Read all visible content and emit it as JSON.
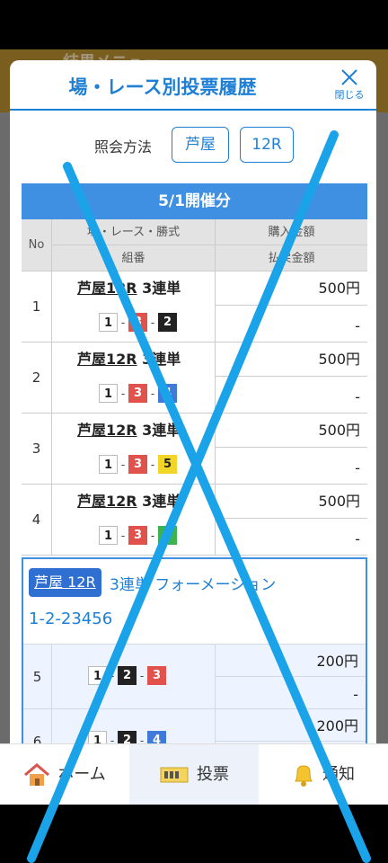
{
  "background": {
    "menu_title": "結果メニュー"
  },
  "modal": {
    "title": "場・レース別投票履歴",
    "close_label": "閉じる",
    "query_label": "照会方法",
    "query_buttons": [
      "芦屋",
      "12R"
    ]
  },
  "table": {
    "date_header": "5/1開催分",
    "headers": {
      "no": "No",
      "race": "場・レース・勝式",
      "combo": "組番",
      "purchase": "購入金額",
      "payout": "払戻金額"
    },
    "rows": [
      {
        "no": "1",
        "race": "芦屋12R",
        "bet_type": "3連単",
        "combo": [
          "1",
          "3",
          "2"
        ],
        "amount": "500円",
        "payout": "-"
      },
      {
        "no": "2",
        "race": "芦屋12R",
        "bet_type": "3連単",
        "combo": [
          "1",
          "3",
          "4"
        ],
        "amount": "500円",
        "payout": "-"
      },
      {
        "no": "3",
        "race": "芦屋12R",
        "bet_type": "3連単",
        "combo": [
          "1",
          "3",
          "5"
        ],
        "amount": "500円",
        "payout": "-"
      },
      {
        "no": "4",
        "race": "芦屋12R",
        "bet_type": "3連単",
        "combo": [
          "1",
          "3",
          "6"
        ],
        "amount": "500円",
        "payout": "-"
      }
    ]
  },
  "formation": {
    "tag": "芦屋 12R",
    "type": "3連単 フォーメーション",
    "combo": "1-2-23456",
    "rows": [
      {
        "no": "5",
        "combo": [
          "1",
          "2",
          "3"
        ],
        "amount": "200円",
        "payout": "-"
      },
      {
        "no": "6",
        "combo": [
          "1",
          "2",
          "4"
        ],
        "amount": "200円",
        "payout": ""
      }
    ]
  },
  "nav": {
    "items": [
      {
        "label": "ホーム",
        "icon": "home-icon"
      },
      {
        "label": "投票",
        "icon": "ticket-icon"
      },
      {
        "label": "通知",
        "icon": "bell-icon"
      }
    ]
  },
  "colors": {
    "accent": "#1e7fd6",
    "header_bar": "#3f8fe3",
    "boat_colors": {
      "1": "#ffffff",
      "2": "#222222",
      "3": "#e2524d",
      "4": "#3f79d9",
      "5": "#f1d629",
      "6": "#3db24f"
    },
    "overlay_x": "#1aa3e8"
  }
}
